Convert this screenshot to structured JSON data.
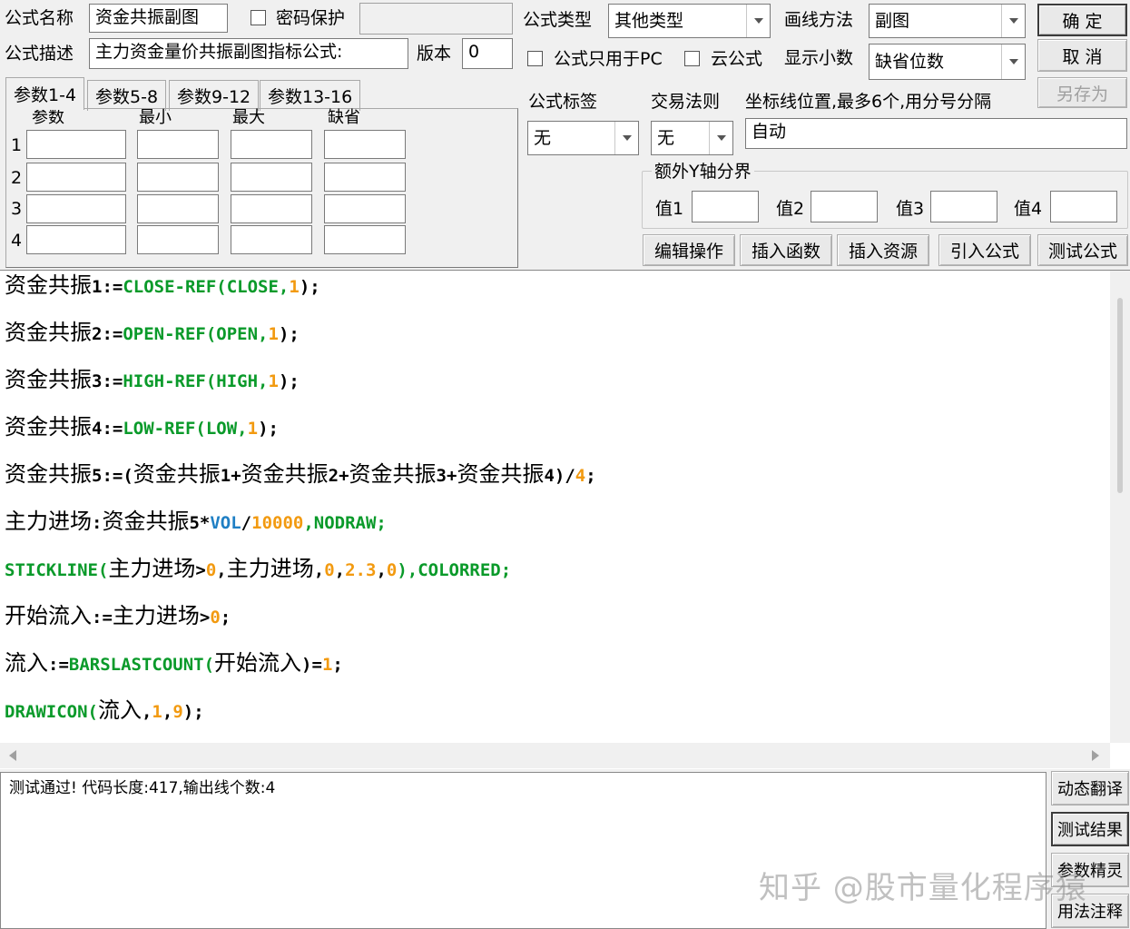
{
  "formula": {
    "name_label": "公式名称",
    "name_value": "资金共振副图",
    "password_label": "密码保护",
    "desc_label": "公式描述",
    "desc_value": "主力资金量价共振副图指标公式:",
    "version_label": "版本",
    "version_value": "0"
  },
  "type": {
    "label": "公式类型",
    "value": "其他类型",
    "pc_only_label": "公式只用于PC",
    "cloud_label": "云公式"
  },
  "draw": {
    "label": "画线方法",
    "value": "副图",
    "decimals_label": "显示小数",
    "decimals_value": "缺省位数"
  },
  "buttons": {
    "ok": "确 定",
    "cancel": "取 消",
    "save_as": "另存为",
    "edit_ops": "编辑操作",
    "insert_func": "插入函数",
    "insert_res": "插入资源",
    "import_formula": "引入公式",
    "test_formula": "测试公式"
  },
  "param_tabs": [
    "参数1-4",
    "参数5-8",
    "参数9-12",
    "参数13-16"
  ],
  "param_headers": [
    "参数",
    "最小",
    "最大",
    "缺省"
  ],
  "param_rows": [
    "1",
    "2",
    "3",
    "4"
  ],
  "tag": {
    "label": "公式标签",
    "value": "无"
  },
  "trade": {
    "label": "交易法则",
    "value": "无"
  },
  "coord": {
    "label": "坐标线位置,最多6个,用分号分隔",
    "value": "自动"
  },
  "yaxis": {
    "group_label": "额外Y轴分界",
    "v1_label": "值1",
    "v2_label": "值2",
    "v3_label": "值3",
    "v4_label": "值4"
  },
  "code": {
    "l1": {
      "a": "资金共振",
      "b": "1:=",
      "c": "CLOSE-REF(CLOSE,",
      "d": "1",
      "e": ");"
    },
    "l2": {
      "a": "资金共振",
      "b": "2:=",
      "c": "OPEN-REF(OPEN,",
      "d": "1",
      "e": ");"
    },
    "l3": {
      "a": "资金共振",
      "b": "3:=",
      "c": "HIGH-REF(HIGH,",
      "d": "1",
      "e": ");"
    },
    "l4": {
      "a": "资金共振",
      "b": "4:=",
      "c": "LOW-REF(LOW,",
      "d": "1",
      "e": ");"
    },
    "l5": {
      "a": "资金共振",
      "b": "5:=(",
      "c": "资金共振",
      "d": "1+",
      "e": "资金共振",
      "f": "2+",
      "g": "资金共振",
      "h": "3+",
      "i": "资金共振",
      "j": "4)/",
      "k": "4",
      "l": ";"
    },
    "l6": {
      "a": "主力进场",
      "b": ":",
      "c": "资金共振",
      "d": "5*",
      "e": "VOL",
      "f": "/",
      "g": "10000",
      "h": ",NODRAW;"
    },
    "l7": {
      "a": "STICKLINE(",
      "b": "主力进场",
      "c": ">",
      "d": "0",
      "e": ",",
      "f": "主力进场",
      "g": ",",
      "h": "0",
      "i": ",",
      "j": "2.3",
      "k": ",",
      "l": "0",
      "m": "),COLORRED;"
    },
    "l8": {
      "a": "开始流入",
      "b": ":=",
      "c": "主力进场",
      "d": ">",
      "e": "0",
      "f": ";"
    },
    "l9": {
      "a": "流入",
      "b": ":=",
      "c": "BARSLASTCOUNT(",
      "d": "开始流入",
      "e": ")=",
      "f": "1",
      "g": ";"
    },
    "l10": {
      "a": "DRAWICON(",
      "b": "流入",
      "c": ",",
      "d": "1",
      "e": ",",
      "f": "9",
      "g": ");"
    }
  },
  "output": {
    "text": "测试通过! 代码长度:417,输出线个数:4"
  },
  "side_buttons": [
    "动态翻译",
    "测试结果",
    "参数精灵",
    "用法注释"
  ],
  "watermark": "知乎 @股市量化程序猿",
  "colors": {
    "function": "#0a9a2a",
    "number": "#f29a10",
    "keyword": "#1f7fc4"
  }
}
